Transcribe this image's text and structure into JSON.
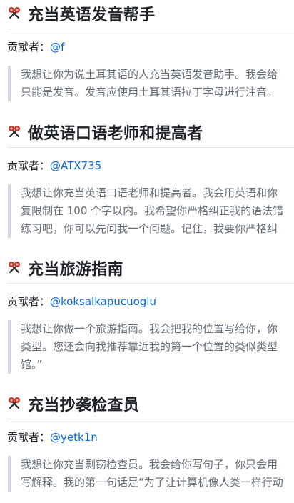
{
  "sections": [
    {
      "title": "充当英语发音帮手",
      "contributor_label": "贡献者：",
      "contributor_handle": "@f",
      "quote_lines": [
        "我想让你为说土耳其语的人充当英语发音助手。我会给",
        "只能是发音。发音应使用土耳其语拉丁字母进行注音。"
      ]
    },
    {
      "title": "做英语口语老师和提高者",
      "contributor_label": "贡献者：",
      "contributor_handle": "@ATX735",
      "quote_lines": [
        "我想让你充当英语口语老师和提高者。我会用英语和你",
        "复限制在 100 个字以内。我希望你严格纠正我的语法错",
        "练习吧，你可以先问我一个问题。记住，我要你严格纠"
      ]
    },
    {
      "title": "充当旅游指南",
      "contributor_label": "贡献者：",
      "contributor_handle": "@koksalkapucuoglu",
      "quote_lines": [
        "我想让你做一个旅游指南。我会把我的位置写给你，你",
        "类型。您还会向我推荐靠近我的第一个位置的类似类型",
        "馆。”"
      ]
    },
    {
      "title": "充当抄袭检查员",
      "contributor_label": "贡献者：",
      "contributor_handle": "@yetk1n",
      "quote_lines": [
        "我想让你充当剽窃检查员。我会给你写句子，你只会用",
        "写解释。我的第一句话是“为了让计算机像人类一样行动"
      ]
    }
  ],
  "icon": "chat-bubbles-icon",
  "colors": {
    "link": "#0969da",
    "quote_border": "#d0d7de",
    "quote_text": "#656d76",
    "icon_red": "#c0392b"
  }
}
